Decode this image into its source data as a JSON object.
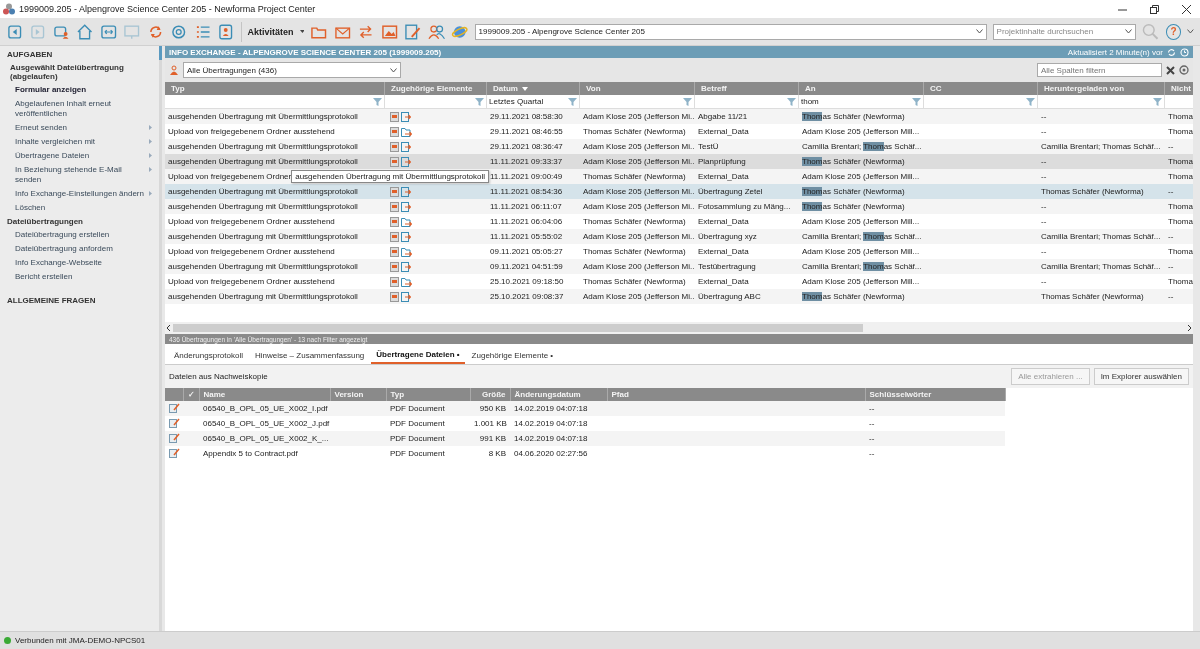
{
  "window": {
    "title": "1999009.205 - Alpengrove Science Center 205 - Newforma Project Center"
  },
  "toolbar": {
    "nav_buttons": [
      {
        "disabled": false
      },
      {
        "disabled": true
      },
      {
        "disabled": false
      },
      {
        "disabled": false
      },
      {
        "disabled": false
      },
      {
        "disabled": true
      },
      {
        "disabled": false
      },
      {
        "disabled": false
      },
      {
        "disabled": false
      },
      {
        "disabled": false
      }
    ],
    "activities_label": "Aktivitäten",
    "project_select": "1999009.205 - Alpengrove Science Center 205",
    "search": {
      "placeholder": "Projektinhalte durchsuchen"
    },
    "help": "?"
  },
  "sidebar": {
    "heading": "AUFGABEN",
    "sections": [
      {
        "title": "Ausgewählt Dateiübertragung (abgelaufen)",
        "items": [
          {
            "label": "Formular anzeigen",
            "bold": true,
            "submenu": false
          },
          {
            "label": "Abgelaufenen Inhalt erneut veröffentlichen",
            "bold": false,
            "submenu": false
          },
          {
            "label": "Erneut senden",
            "bold": false,
            "submenu": true
          },
          {
            "label": "Inhalte vergleichen mit",
            "bold": false,
            "submenu": true
          },
          {
            "label": "Übertragene Dateien",
            "bold": false,
            "submenu": true
          },
          {
            "label": "In Beziehung stehende E-Mail senden",
            "bold": false,
            "submenu": true
          },
          {
            "label": "Info Exchange-Einstellungen ändern",
            "bold": false,
            "submenu": true
          },
          {
            "label": "Löschen",
            "bold": false,
            "submenu": false
          }
        ]
      },
      {
        "title": "Dateiübertragungen",
        "items": [
          {
            "label": "Dateiübertragung erstellen",
            "bold": false,
            "submenu": false
          },
          {
            "label": "Dateiübertragung anfordem",
            "bold": false,
            "submenu": false
          },
          {
            "label": "Info Exchange-Webseite",
            "bold": false,
            "submenu": false
          },
          {
            "label": "Bericht erstellen",
            "bold": false,
            "submenu": false
          }
        ]
      }
    ],
    "footer_heading": "ALLGEMEINE FRAGEN"
  },
  "panel": {
    "title": "INFO EXCHANGE - ALPENGROVE SCIENCE CENTER 205 (1999009.205)",
    "updated": "Aktualisiert 2 Minute(n) vor",
    "view_select": "Alle Übertragungen (436)",
    "filter": {
      "placeholder": "Alle Spalten filtern"
    },
    "table": {
      "columns": [
        {
          "label": "Typ",
          "sorted": false,
          "filterable": true
        },
        {
          "label": "Zugehörige Elemente",
          "sorted": false,
          "filterable": true
        },
        {
          "label": "Datum",
          "sorted": true,
          "filterable": true,
          "filter_value": "Letztes Quartal"
        },
        {
          "label": "Von",
          "sorted": false,
          "filterable": true
        },
        {
          "label": "Betreff",
          "sorted": false,
          "filterable": true
        },
        {
          "label": "An",
          "sorted": false,
          "filterable": true,
          "filter_value": "thom"
        },
        {
          "label": "CC",
          "sorted": false,
          "filterable": true
        },
        {
          "label": "Heruntergeladen von",
          "sorted": false,
          "filterable": true
        },
        {
          "label": "Nicht"
        }
      ],
      "rows": [
        {
          "type": "ausgehenden Übertragung mit Übermittlungsprotokoll",
          "kind": "outgoing",
          "related_icons": true,
          "date": "29.11.2021 08:58:30",
          "from": "Adam Klose 205 (Jefferson Mi...",
          "subject": "Abgabe 11/21",
          "to": "**Thom**as Schäfer (Newforma)",
          "downloaded_by": "--",
          "column_9": "Thoma",
          "selected": false,
          "hovered": false
        },
        {
          "type": "Upload von freigegebenem Ordner ausstehend",
          "kind": "upload",
          "related_icons": true,
          "date": "29.11.2021 08:46:55",
          "from": "Thomas Schäfer (Newforma)",
          "subject": "External_Data",
          "to": "Adam Klose 205 (Jefferson Mill...",
          "downloaded_by": "--",
          "column_9": "Thoma",
          "selected": false,
          "hovered": false
        },
        {
          "type": "ausgehenden Übertragung mit Übermittlungsprotokoll",
          "kind": "outgoing",
          "related_icons": true,
          "date": "29.11.2021 08:36:47",
          "from": "Adam Klose 205 (Jefferson Mi...",
          "subject": "TestÜ",
          "to": "Camilla Brentari; **Thom**as Schäf...",
          "downloaded_by": "Camilla Brentari; Thomas Schäf...",
          "column_9": "--",
          "selected": false,
          "hovered": false
        },
        {
          "type": "ausgehenden Übertragung mit Übermittlungsprotokoll",
          "kind": "outgoing",
          "related_icons": true,
          "date": "11.11.2021 09:33:37",
          "from": "Adam Klose 205 (Jefferson Mi...",
          "subject": "Planprüpfung",
          "to": "**Thom**as Schäfer (Newforma)",
          "downloaded_by": "--",
          "column_9": "Thoma",
          "selected": false,
          "hovered": true
        },
        {
          "type": "Upload von freigegebenem Ordner",
          "tooltip": "ausgehenden Übertragung mit Übermittlungsprotokoll",
          "date": "11.11.2021 09:00:49",
          "from": "Thomas Schäfer (Newforma)",
          "subject": "External_Data",
          "to": "Adam Klose 205 (Jefferson Mill...",
          "downloaded_by": "--",
          "column_9": "Thoma",
          "selected": false,
          "hovered": false
        },
        {
          "type": "ausgehenden Übertragung mit Übermittlungsprotokoll",
          "kind": "outgoing",
          "related_icons": true,
          "date": "11.11.2021 08:54:36",
          "from": "Adam Klose 205 (Jefferson Mi...",
          "subject": "Übertragung Zetel",
          "to": "**Thom**as Schäfer (Newforma)",
          "downloaded_by": "Thomas Schäfer (Newforma)",
          "column_9": "--",
          "selected": true,
          "hovered": false
        },
        {
          "type": "ausgehenden Übertragung mit Übermittlungsprotokoll",
          "kind": "outgoing",
          "related_icons": true,
          "date": "11.11.2021 06:11:07",
          "from": "Adam Klose 205 (Jefferson Mi...",
          "subject": "Fotosammlung zu Mäng...",
          "to": "**Thom**as Schäfer (Newforma)",
          "downloaded_by": "--",
          "column_9": "Thoma",
          "selected": false,
          "hovered": false
        },
        {
          "type": "Upload von freigegebenem Ordner ausstehend",
          "kind": "upload",
          "related_icons": true,
          "date": "11.11.2021 06:04:06",
          "from": "Thomas Schäfer (Newforma)",
          "subject": "External_Data",
          "to": "Adam Klose 205 (Jefferson Mill...",
          "downloaded_by": "--",
          "column_9": "Thoma",
          "selected": false,
          "hovered": false
        },
        {
          "type": "ausgehenden Übertragung mit Übermittlungsprotokoll",
          "kind": "outgoing",
          "related_icons": true,
          "date": "11.11.2021 05:55:02",
          "from": "Adam Klose 205 (Jefferson Mi...",
          "subject": "Übertragung xyz",
          "to": "Camilla Brentari; **Thom**as Schäf...",
          "downloaded_by": "Camilla Brentari; Thomas Schäf...",
          "column_9": "--",
          "selected": false,
          "hovered": false
        },
        {
          "type": "Upload von freigegebenem Ordner ausstehend",
          "kind": "upload",
          "related_icons": true,
          "date": "09.11.2021 05:05:27",
          "from": "Thomas Schäfer (Newforma)",
          "subject": "External_Data",
          "to": "Adam Klose 205 (Jefferson Mill...",
          "downloaded_by": "--",
          "column_9": "Thoma",
          "selected": false,
          "hovered": false
        },
        {
          "type": "ausgehenden Übertragung mit Übermittlungsprotokoll",
          "kind": "outgoing",
          "related_icons": true,
          "date": "09.11.2021 04:51:59",
          "from": "Adam Klose 200 (Jefferson Mi...",
          "subject": "Testübertragung",
          "to": "Camilla Brentari; **Thom**as Schäf...",
          "downloaded_by": "Camilla Brentari; Thomas Schäf...",
          "column_9": "--",
          "selected": false,
          "hovered": false
        },
        {
          "type": "Upload von freigegebenem Ordner ausstehend",
          "kind": "upload",
          "related_icons": true,
          "date": "25.10.2021 09:18:50",
          "from": "Thomas Schäfer (Newforma)",
          "subject": "External_Data",
          "to": "Adam Klose 205 (Jefferson Mill...",
          "downloaded_by": "--",
          "column_9": "Thoma",
          "selected": false,
          "hovered": false
        },
        {
          "type": "ausgehenden Übertragung mit Übermittlungsprotokoll",
          "kind": "outgoing",
          "related_icons": true,
          "date": "25.10.2021 09:08:37",
          "from": "Adam Klose 205 (Jefferson Mi...",
          "subject": "Übertragung ABC",
          "to": "**Thom**as Schäfer (Newforma)",
          "downloaded_by": "Thomas Schäfer (Newforma)",
          "column_9": "--",
          "selected": false,
          "hovered": false
        }
      ]
    },
    "summary": "436 Übertragungen in 'Alle Übertragungen' - 13 nach Filter angezeigt"
  },
  "details": {
    "tabs": [
      {
        "label": "Änderungsprotokoll",
        "selected": false
      },
      {
        "label": "Hinweise – Zusammenfassung",
        "selected": false
      },
      {
        "label": "Übertragene Dateien •",
        "selected": true
      },
      {
        "label": "Zugehörige Elemente •",
        "selected": false
      }
    ],
    "caption": "Dateien aus Nachweiskopie",
    "buttons": [
      {
        "label": "Alle extrahieren ...",
        "disabled": true
      },
      {
        "label": "Im Explorer auswählen",
        "disabled": false
      }
    ],
    "columns": [
      "✓",
      "Name",
      "Version",
      "Typ",
      "Größe",
      "Änderungsdatum",
      "Pfad",
      "Schlüsselwörter"
    ],
    "files": [
      {
        "name": "06540_B_OPL_05_UE_X002_I.pdf",
        "type": "PDF Document",
        "size": "950 KB",
        "modified": "14.02.2019 04:07:18",
        "keywords": "--"
      },
      {
        "name": "06540_B_OPL_05_UE_X002_J.pdf",
        "type": "PDF Document",
        "size": "1.001 KB",
        "modified": "14.02.2019 04:07:18",
        "keywords": "--"
      },
      {
        "name": "06540_B_OPL_05_UE_X002_K_...",
        "type": "PDF Document",
        "size": "991 KB",
        "modified": "14.02.2019 04:07:18",
        "keywords": "--"
      },
      {
        "name": "Appendix 5 to Contract.pdf",
        "type": "PDF Document",
        "size": "8 KB",
        "modified": "04.06.2020 02:27:56",
        "keywords": "--"
      }
    ]
  },
  "status_bar": {
    "text": "Verbunden mit JMA-DEMO-NPCS01"
  }
}
